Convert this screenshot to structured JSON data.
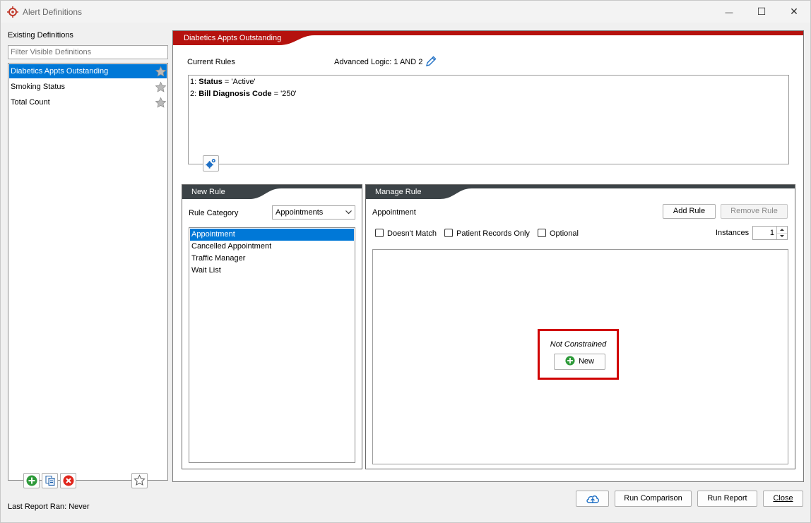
{
  "window": {
    "title": "Alert Definitions",
    "minimize_glyph": "—",
    "maximize_glyph": "☐",
    "close_glyph": "✕"
  },
  "sidebar": {
    "heading": "Existing Definitions",
    "filter_placeholder": "Filter Visible Definitions",
    "items": [
      {
        "label": "Diabetics Appts Outstanding",
        "selected": true
      },
      {
        "label": "Smoking Status",
        "selected": false
      },
      {
        "label": "Total Count",
        "selected": false
      }
    ],
    "last_report": "Last Report Ran: Never"
  },
  "definition": {
    "title": "Diabetics Appts Outstanding",
    "current_rules_label": "Current Rules",
    "advanced_logic": "Advanced Logic: 1 AND 2",
    "rules": [
      {
        "num": "1: ",
        "field": "Status",
        "rest": " = 'Active'"
      },
      {
        "num": "2: ",
        "field": "Bill Diagnosis Code",
        "rest": " = '250'"
      }
    ]
  },
  "new_rule": {
    "header": "New Rule",
    "category_label": "Rule Category",
    "category_value": "Appointments",
    "items": [
      {
        "label": "Appointment",
        "selected": true
      },
      {
        "label": "Cancelled Appointment",
        "selected": false
      },
      {
        "label": "Traffic Manager",
        "selected": false
      },
      {
        "label": "Wait List",
        "selected": false
      }
    ]
  },
  "manage_rule": {
    "header": "Manage Rule",
    "subject": "Appointment",
    "add_rule": "Add Rule",
    "remove_rule": "Remove Rule",
    "doesnt_match": "Doesn't Match",
    "patient_records_only": "Patient Records Only",
    "optional": "Optional",
    "instances_label": "Instances",
    "instances_value": "1",
    "not_constrained": "Not Constrained",
    "new_label": "New"
  },
  "footer": {
    "run_comparison": "Run Comparison",
    "run_report": "Run Report",
    "close": "Close"
  },
  "colors": {
    "accent_red": "#b5120e",
    "dark_tab": "#3c4347",
    "selection": "#0078d7",
    "highlight_box": "#d00000",
    "green": "#2e9a3a"
  }
}
